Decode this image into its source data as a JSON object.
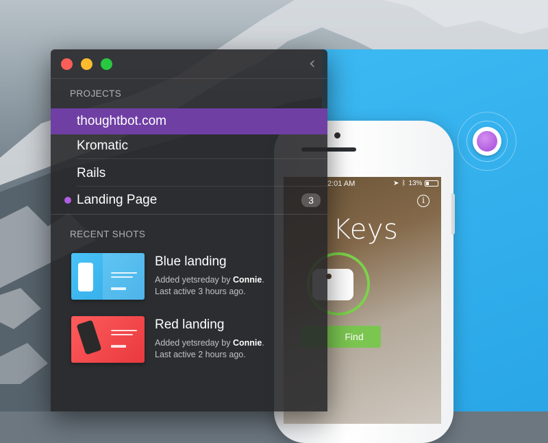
{
  "window": {
    "projects_header": "PROJECTS",
    "projects": [
      {
        "label": "thoughtbot.com",
        "selected": true
      },
      {
        "label": "Kromatic"
      },
      {
        "label": "Rails"
      },
      {
        "label": "Landing Page",
        "dot_color": "#b15ee0",
        "badge": "3"
      }
    ],
    "recent_header": "RECENT SHOTS",
    "shots": [
      {
        "title": "Blue landing",
        "added_prefix": "Added yetsreday by ",
        "author": "Connie",
        "added_suffix": ".",
        "last_active": "Last active 3 hours ago.",
        "thumb_color": "#3db7f0"
      },
      {
        "title": "Red landing",
        "added_prefix": "Added yetsreday by ",
        "author": "Connie",
        "added_suffix": ".",
        "last_active": "Last active 2 hours ago.",
        "thumb_color": "#f04848"
      }
    ]
  },
  "phone": {
    "time": "2:01 AM",
    "battery": "13%",
    "app_title": "Keys",
    "find_label": "Find"
  },
  "icons": {
    "window_controls": [
      "close-icon",
      "minimize-icon",
      "maximize-icon"
    ],
    "back": "chevron-left-icon",
    "record": "record-icon",
    "info": "info-icon"
  },
  "colors": {
    "selected_row": "#6f3fa4",
    "accent_blue": "#2fadeb",
    "record_purple": "#b15ee0",
    "find_green": "#7bc651"
  }
}
